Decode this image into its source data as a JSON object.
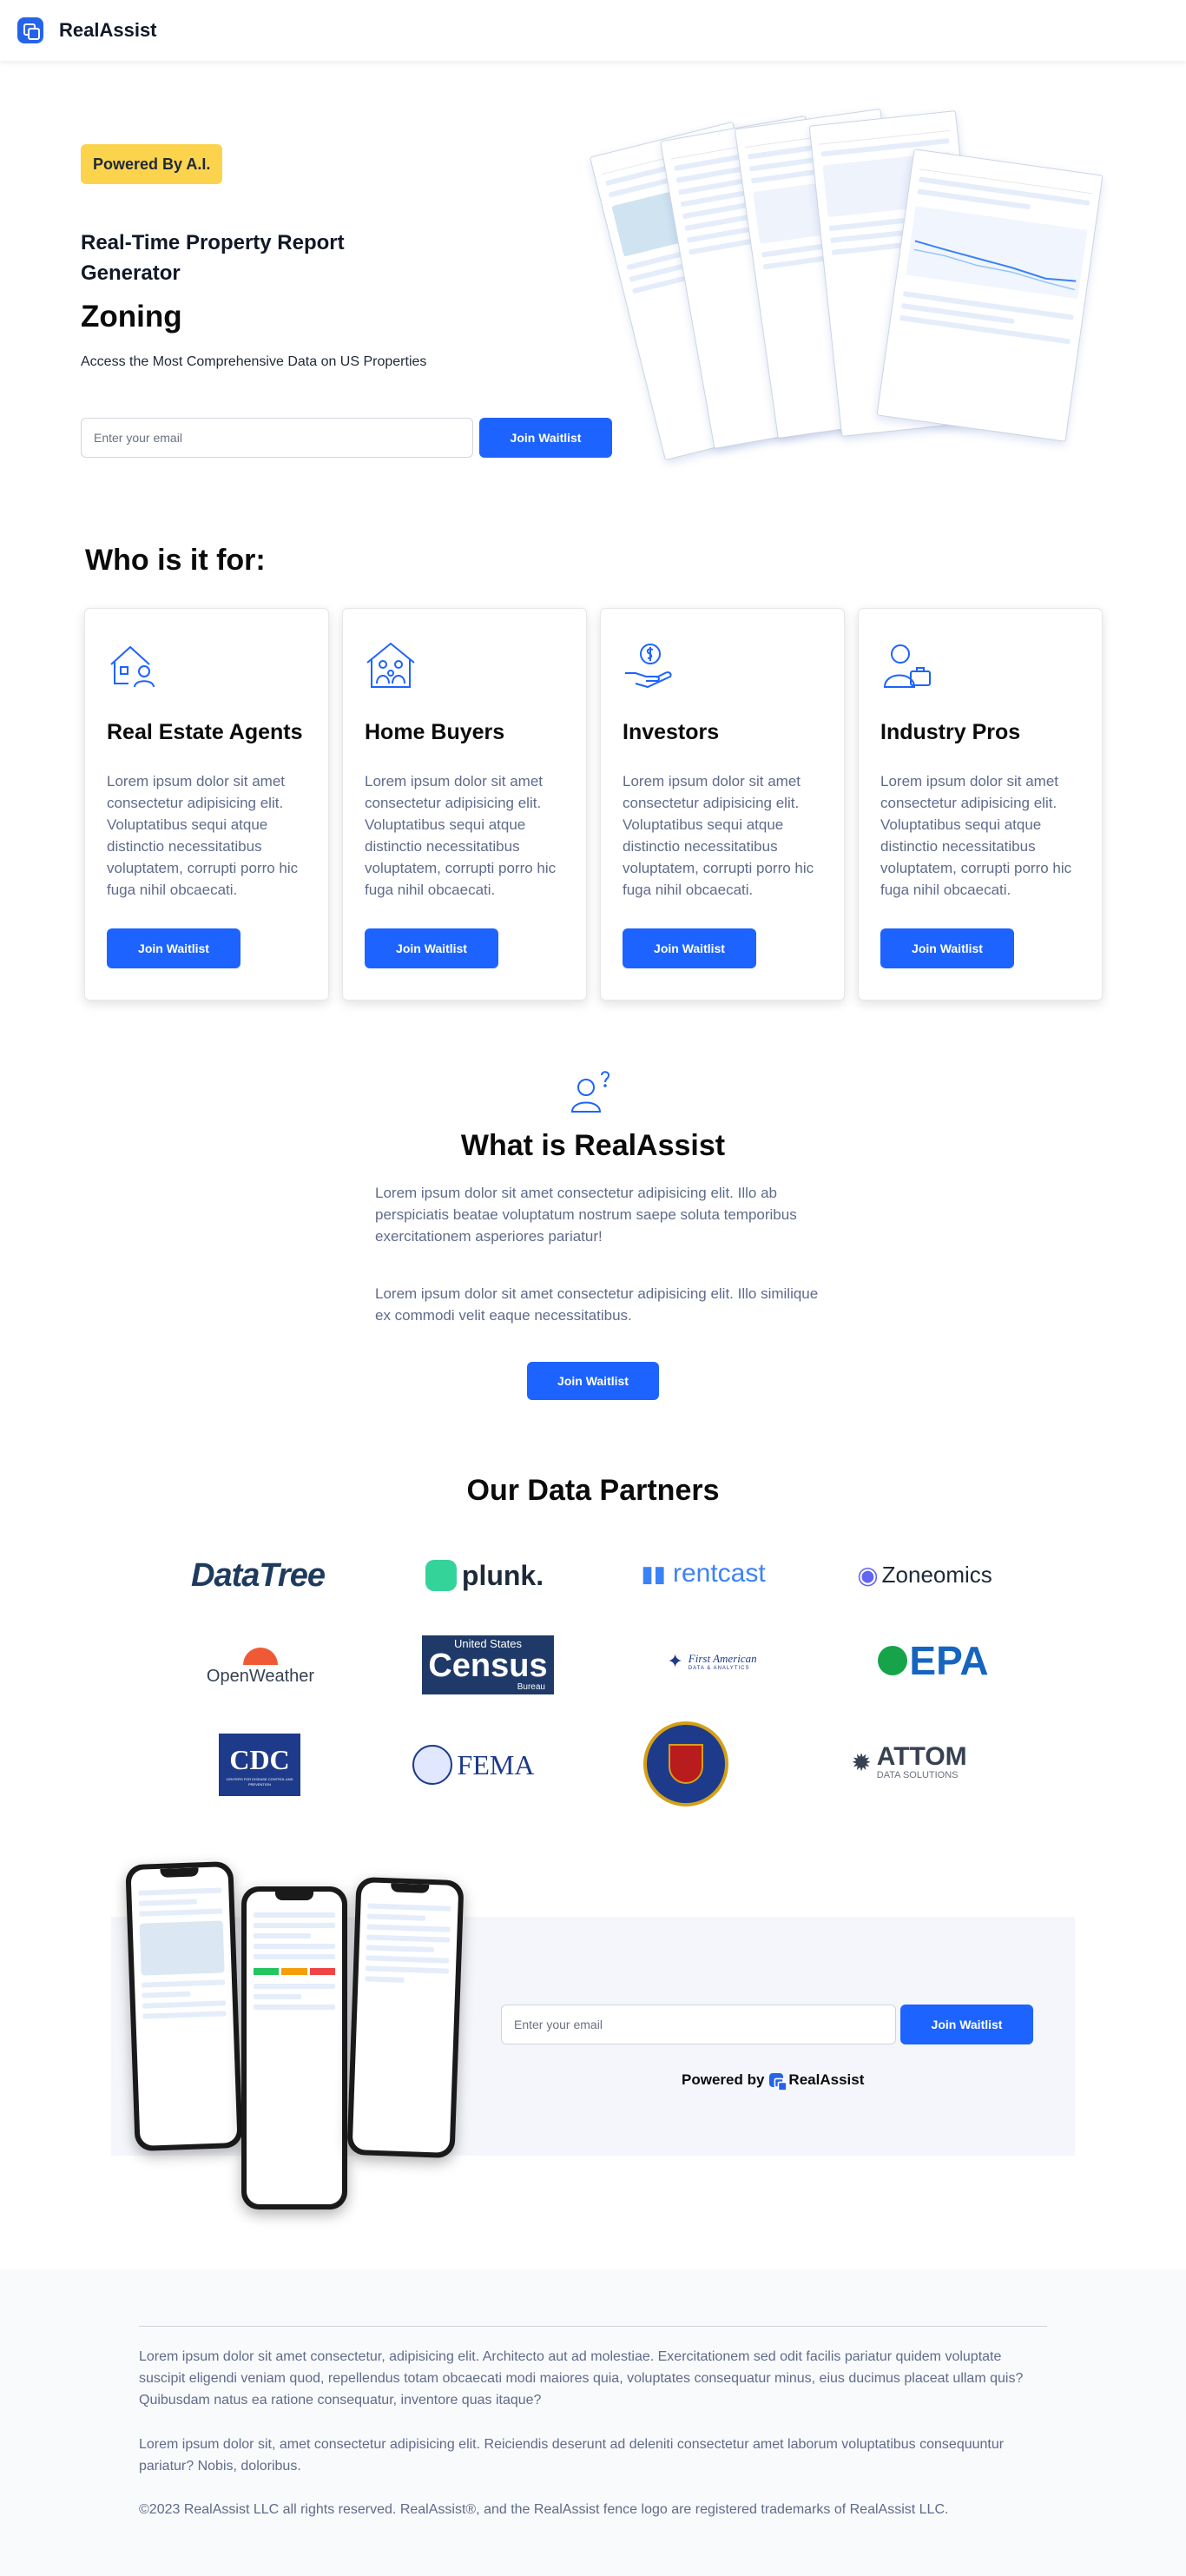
{
  "header": {
    "brand": "RealAssist"
  },
  "hero": {
    "badge": "Powered By A.I.",
    "subtitle": "Real-Time Property Report Generator",
    "title": "Zoning",
    "description": "Access the Most Comprehensive Data on US Properties",
    "email_placeholder": "Enter your email",
    "button": "Join Waitlist"
  },
  "audience": {
    "title": "Who is it for:",
    "cards": [
      {
        "icon": "house-agent-icon",
        "title": "Real Estate Agents",
        "text": "Lorem ipsum dolor sit amet consectetur adipisicing elit. Voluptatibus sequi atque distinctio necessitatibus voluptatem, corrupti porro hic fuga nihil obcaecati.",
        "button": "Join Waitlist"
      },
      {
        "icon": "family-house-icon",
        "title": "Home Buyers",
        "text": "Lorem ipsum dolor sit amet consectetur adipisicing elit. Voluptatibus sequi atque distinctio necessitatibus voluptatem, corrupti porro hic fuga nihil obcaecati.",
        "button": "Join Waitlist"
      },
      {
        "icon": "hand-dollar-icon",
        "title": "Investors",
        "text": "Lorem ipsum dolor sit amet consectetur adipisicing elit. Voluptatibus sequi atque distinctio necessitatibus voluptatem, corrupti porro hic fuga nihil obcaecati.",
        "button": "Join Waitlist"
      },
      {
        "icon": "professional-briefcase-icon",
        "title": "Industry Pros",
        "text": "Lorem ipsum dolor sit amet consectetur adipisicing elit. Voluptatibus sequi atque distinctio necessitatibus voluptatem, corrupti porro hic fuga nihil obcaecati.",
        "button": "Join Waitlist"
      }
    ]
  },
  "what": {
    "icon": "person-question-icon",
    "title": "What is RealAssist",
    "p1": "Lorem ipsum dolor sit amet consectetur adipisicing elit. Illo ab perspiciatis beatae voluptatum nostrum saepe soluta temporibus exercitationem asperiores pariatur!",
    "p2": "Lorem ipsum dolor sit amet consectetur adipisicing elit. Illo similique ex commodi velit eaque necessitatibus.",
    "button": "Join Waitlist"
  },
  "partners": {
    "title": "Our Data Partners",
    "logos": [
      {
        "name": "DataTree",
        "text": "DataTree"
      },
      {
        "name": "plunk",
        "text": "plunk."
      },
      {
        "name": "rentcast",
        "text": "rentcast"
      },
      {
        "name": "Zoneomics",
        "text": "Zoneomics"
      },
      {
        "name": "OpenWeather",
        "text": "OpenWeather"
      },
      {
        "name": "Census",
        "text_top": "United States",
        "text_main": "Census",
        "text_bottom": "Bureau"
      },
      {
        "name": "First American",
        "text": "First American",
        "sub": "DATA & ANALYTICS"
      },
      {
        "name": "EPA",
        "text": "EPA"
      },
      {
        "name": "CDC",
        "text": "CDC",
        "sub": "CENTERS FOR DISEASE CONTROL AND PREVENTION"
      },
      {
        "name": "FEMA",
        "text": "FEMA"
      },
      {
        "name": "FBI",
        "text": ""
      },
      {
        "name": "ATTOM",
        "text": "ATTOM",
        "sub": "DATA SOLUTIONS"
      }
    ]
  },
  "cta": {
    "email_placeholder": "Enter your email",
    "button": "Join Waitlist",
    "powered_by": "Powered by",
    "brand": "RealAssist"
  },
  "footer": {
    "p1": "Lorem ipsum dolor sit amet consectetur, adipisicing elit. Architecto aut ad molestiae. Exercitationem sed odit facilis pariatur quidem voluptate suscipit eligendi veniam quod, repellendus totam obcaecati modi maiores quia, voluptates consequatur minus, eius ducimus placeat ullam quis? Quibusdam natus ea ratione consequatur, inventore quas itaque?",
    "p2": "Lorem ipsum dolor sit, amet consectetur adipisicing elit. Reiciendis deserunt ad deleniti consectetur amet laborum voluptatibus consequuntur pariatur? Nobis, doloribus.",
    "copyright": "©2023 RealAssist LLC all rights reserved. RealAssist®, and the RealAssist fence logo are registered trademarks of RealAssist LLC."
  },
  "colors": {
    "accent": "#1d63ff",
    "badge": "#fcd34d",
    "muted_text": "#5f6b8a"
  }
}
